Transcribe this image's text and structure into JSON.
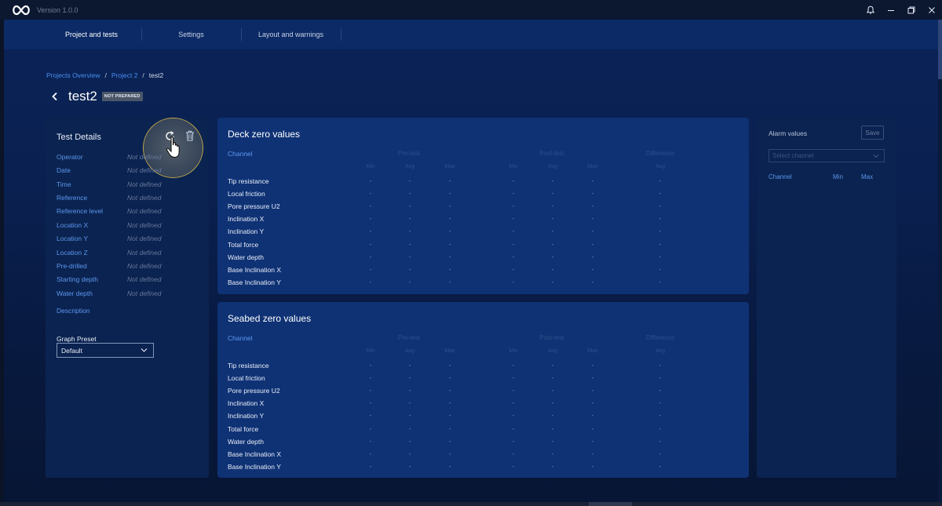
{
  "window": {
    "version": "Version 1.0.0",
    "icons": [
      "bell-icon",
      "minimize-icon",
      "restore-icon",
      "close-icon"
    ]
  },
  "nav": {
    "tabs": [
      {
        "label": "Project and tests",
        "active": true
      },
      {
        "label": "Settings",
        "active": false
      },
      {
        "label": "Layout and warnings",
        "active": false
      }
    ]
  },
  "breadcrumb": {
    "items": [
      "Projects Overview",
      "Project 2",
      "test2"
    ],
    "separator": "/"
  },
  "page": {
    "title": "test2",
    "status": "NOT PREPARED"
  },
  "details": {
    "title": "Test Details",
    "fields": [
      {
        "label": "Operator",
        "value": "Not defined"
      },
      {
        "label": "Date",
        "value": "Not defined"
      },
      {
        "label": "Time",
        "value": "Not defined"
      },
      {
        "label": "Reference",
        "value": "Not defined"
      },
      {
        "label": "Reference level",
        "value": "Not defined"
      },
      {
        "label": "Location X",
        "value": "Not defined"
      },
      {
        "label": "Location Y",
        "value": "Not defined"
      },
      {
        "label": "Location Z",
        "value": "Not defined"
      },
      {
        "label": "Pre-drilled",
        "value": "Not defined"
      },
      {
        "label": "Starting depth",
        "value": "Not defined"
      },
      {
        "label": "Water depth",
        "value": "Not defined"
      }
    ],
    "description_label": "Description",
    "graph_preset_label": "Graph Preset",
    "graph_preset_value": "Default"
  },
  "deck": {
    "title": "Deck zero values",
    "channel_header": "Channel",
    "groups": [
      "Pre-test",
      "Post-test",
      "Difference"
    ],
    "subcols": [
      "Min",
      "Avg",
      "Max",
      "Min",
      "Avg",
      "Max",
      "Avg"
    ],
    "rows": [
      {
        "channel": "Tip resistance",
        "values": [
          "-",
          "-",
          "-",
          "-",
          "-",
          "-",
          "-"
        ]
      },
      {
        "channel": "Local friction",
        "values": [
          "-",
          "-",
          "-",
          "-",
          "-",
          "-",
          "-"
        ]
      },
      {
        "channel": "Pore pressure U2",
        "values": [
          "-",
          "-",
          "-",
          "-",
          "-",
          "-",
          "-"
        ]
      },
      {
        "channel": "Inclination X",
        "values": [
          "-",
          "-",
          "-",
          "-",
          "-",
          "-",
          "-"
        ]
      },
      {
        "channel": "Inclination Y",
        "values": [
          "-",
          "-",
          "-",
          "-",
          "-",
          "-",
          "-"
        ]
      },
      {
        "channel": "Total force",
        "values": [
          "-",
          "-",
          "-",
          "-",
          "-",
          "-",
          "-"
        ]
      },
      {
        "channel": "Water depth",
        "values": [
          "-",
          "-",
          "-",
          "-",
          "-",
          "-",
          "-"
        ]
      },
      {
        "channel": "Base Inclination X",
        "values": [
          "-",
          "-",
          "-",
          "-",
          "-",
          "-",
          "-"
        ]
      },
      {
        "channel": "Base Inclination Y",
        "values": [
          "-",
          "-",
          "-",
          "-",
          "-",
          "-",
          "-"
        ]
      }
    ]
  },
  "seabed": {
    "title": "Seabed zero values",
    "channel_header": "Channel",
    "groups": [
      "Pre-test",
      "Post-test",
      "Difference"
    ],
    "subcols": [
      "Min",
      "Avg",
      "Max",
      "Min",
      "Avg",
      "Max",
      "Avg"
    ],
    "rows": [
      {
        "channel": "Tip resistance",
        "values": [
          "-",
          "-",
          "-",
          "-",
          "-",
          "-",
          "-"
        ]
      },
      {
        "channel": "Local friction",
        "values": [
          "-",
          "-",
          "-",
          "-",
          "-",
          "-",
          "-"
        ]
      },
      {
        "channel": "Pore pressure U2",
        "values": [
          "-",
          "-",
          "-",
          "-",
          "-",
          "-",
          "-"
        ]
      },
      {
        "channel": "Inclination X",
        "values": [
          "-",
          "-",
          "-",
          "-",
          "-",
          "-",
          "-"
        ]
      },
      {
        "channel": "Inclination Y",
        "values": [
          "-",
          "-",
          "-",
          "-",
          "-",
          "-",
          "-"
        ]
      },
      {
        "channel": "Total force",
        "values": [
          "-",
          "-",
          "-",
          "-",
          "-",
          "-",
          "-"
        ]
      },
      {
        "channel": "Water depth",
        "values": [
          "-",
          "-",
          "-",
          "-",
          "-",
          "-",
          "-"
        ]
      },
      {
        "channel": "Base Inclination X",
        "values": [
          "-",
          "-",
          "-",
          "-",
          "-",
          "-",
          "-"
        ]
      },
      {
        "channel": "Base Inclination Y",
        "values": [
          "-",
          "-",
          "-",
          "-",
          "-",
          "-",
          "-"
        ]
      }
    ]
  },
  "alarm": {
    "title": "Alarm values",
    "save_label": "Save",
    "select_placeholder": "Select channel",
    "columns": [
      "Channel",
      "Min",
      "Max"
    ]
  },
  "colors": {
    "accent_link": "#4b8ef1",
    "panel_bg": "#0f3275",
    "halo_border": "#bba44a"
  }
}
